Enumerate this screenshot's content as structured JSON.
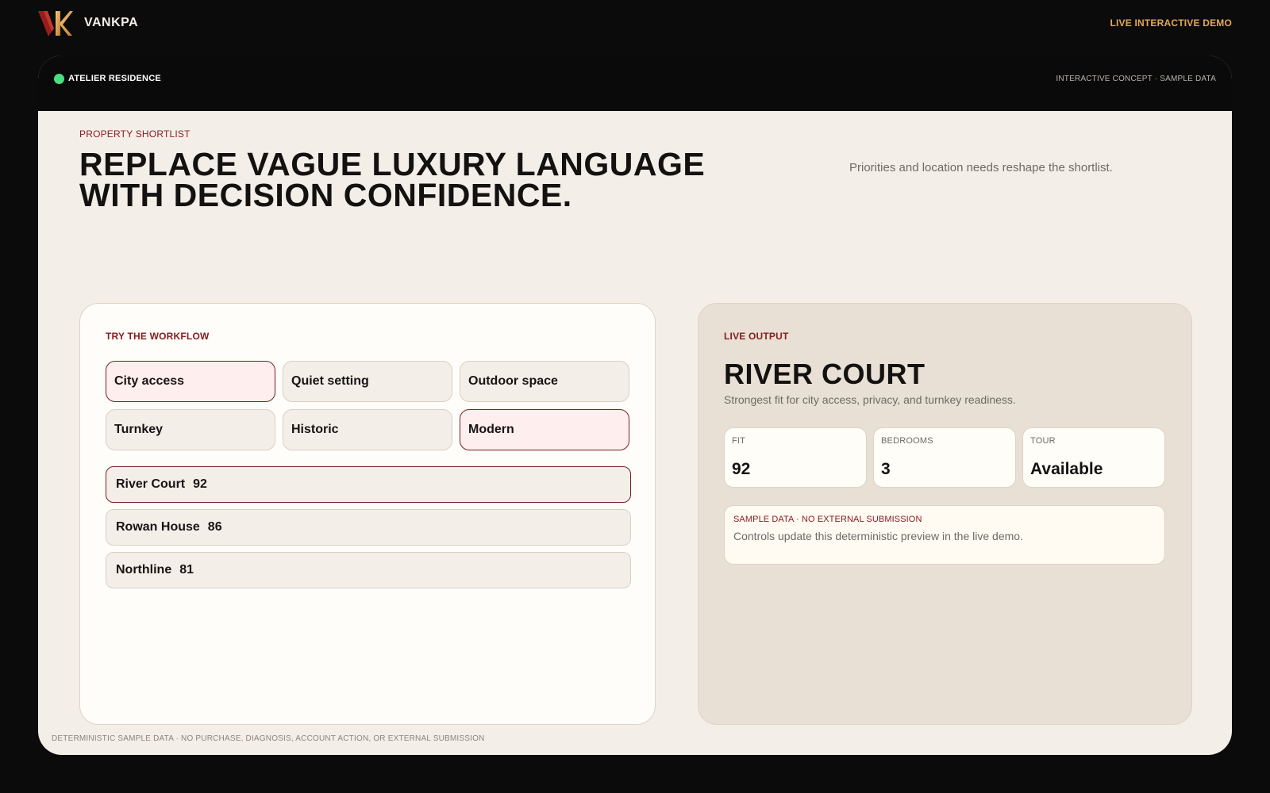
{
  "app": {
    "brand": "VANKPA",
    "demo_link": "LIVE INTERACTIVE DEMO"
  },
  "frame": {
    "residence": "ATELIER RESIDENCE",
    "concept": "INTERACTIVE CONCEPT · SAMPLE DATA",
    "status_color": "#4ade80"
  },
  "hero": {
    "eyebrow": "PROPERTY SHORTLIST",
    "headline": "REPLACE VAGUE LUXURY LANGUAGE WITH DECISION CONFIDENCE.",
    "subtext": "Priorities and location needs reshape the shortlist."
  },
  "workflow": {
    "eyebrow": "TRY THE WORKFLOW",
    "chips": [
      {
        "label": "City access",
        "selected": true
      },
      {
        "label": "Quiet setting",
        "selected": false
      },
      {
        "label": "Outdoor space",
        "selected": false
      },
      {
        "label": "Turnkey",
        "selected": false
      },
      {
        "label": "Historic",
        "selected": false
      },
      {
        "label": "Modern",
        "selected": true
      }
    ],
    "results": [
      {
        "name": "River Court",
        "score": "92",
        "active": true
      },
      {
        "name": "Rowan House",
        "score": "86",
        "active": false
      },
      {
        "name": "Northline",
        "score": "81",
        "active": false
      }
    ]
  },
  "output": {
    "eyebrow": "LIVE OUTPUT",
    "title": "RIVER COURT",
    "subtitle": "Strongest fit for city access, privacy, and turnkey readiness.",
    "stats": [
      {
        "label": "FIT",
        "value": "92"
      },
      {
        "label": "BEDROOMS",
        "value": "3"
      },
      {
        "label": "TOUR",
        "value": "Available"
      }
    ],
    "note_label": "SAMPLE DATA · NO EXTERNAL SUBMISSION",
    "note_text": "Controls update this deterministic preview in the live demo."
  },
  "footer": "DETERMINISTIC SAMPLE DATA · NO PURCHASE, DIAGNOSIS, ACCOUNT ACTION, OR EXTERNAL SUBMISSION",
  "colors": {
    "accent": "#8a1c22",
    "link": "#e3a857",
    "selected_border": "#7b1c23",
    "selected_bg": "#ffeeee"
  }
}
